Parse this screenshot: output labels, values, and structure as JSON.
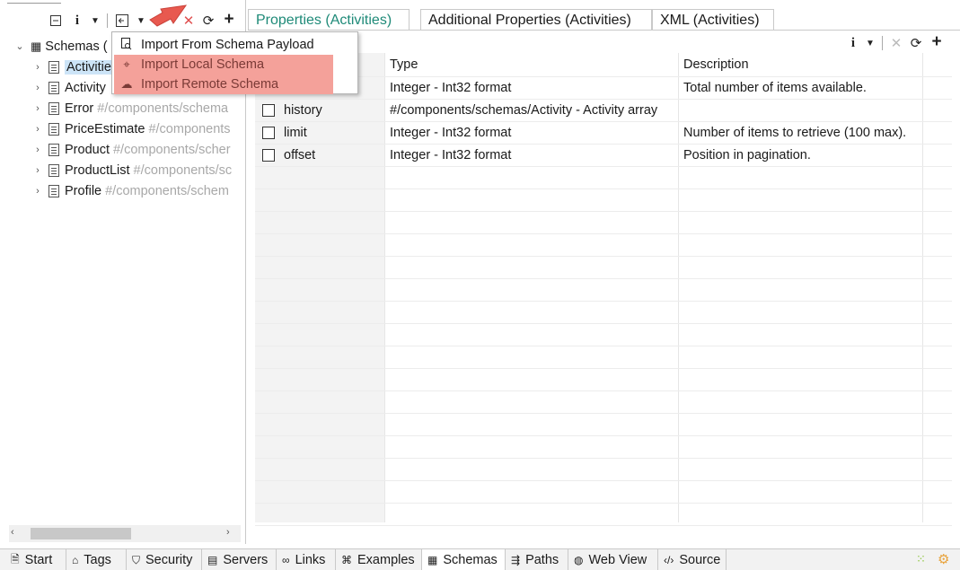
{
  "left_toolbar": {
    "collapse_icon": "collapse-all-icon",
    "info_icon": "info-icon",
    "import_icon": "import-icon",
    "delete_icon": "delete-icon",
    "refresh_icon": "refresh-icon",
    "add_icon": "add-icon"
  },
  "tree": {
    "root_label": "Schemas (",
    "items": [
      {
        "name": "Activitie",
        "ref": "",
        "selected": true
      },
      {
        "name": "Activity",
        "ref": ""
      },
      {
        "name": "Error",
        "ref": "#/components/schema"
      },
      {
        "name": "PriceEstimate",
        "ref": "#/components"
      },
      {
        "name": "Product",
        "ref": "#/components/scher"
      },
      {
        "name": "ProductList",
        "ref": "#/components/sc"
      },
      {
        "name": "Profile",
        "ref": "#/components/schem"
      }
    ]
  },
  "menu": {
    "items": [
      {
        "label": "Import From Schema Payload",
        "icon": "payload-icon"
      },
      {
        "label": "Import Local Schema",
        "icon": "location-icon"
      },
      {
        "label": "Import Remote Schema",
        "icon": "cloud-icon"
      }
    ]
  },
  "tabs": [
    {
      "label": "Properties (Activities)",
      "active": true
    },
    {
      "label": "Additional Properties (Activities)"
    },
    {
      "label": "XML (Activities)"
    }
  ],
  "grid": {
    "headers": {
      "type": "Type",
      "description": "Description"
    },
    "rows": [
      {
        "name": "",
        "type": "Integer - Int32 format",
        "description": "Total number of items available."
      },
      {
        "name": "history",
        "type": "#/components/schemas/Activity - Activity array",
        "description": ""
      },
      {
        "name": "limit",
        "type": "Integer - Int32 format",
        "description": "Number of items to retrieve (100 max)."
      },
      {
        "name": "offset",
        "type": "Integer - Int32 format",
        "description": "Position in pagination."
      }
    ]
  },
  "bottom_tabs": [
    {
      "label": "Start",
      "icon": "document-icon"
    },
    {
      "label": "Tags",
      "icon": "tag-icon"
    },
    {
      "label": "Security",
      "icon": "shield-icon"
    },
    {
      "label": "Servers",
      "icon": "server-icon"
    },
    {
      "label": "Links",
      "icon": "link-icon"
    },
    {
      "label": "Examples",
      "icon": "examples-icon"
    },
    {
      "label": "Schemas",
      "icon": "schemas-icon",
      "active": true
    },
    {
      "label": "Paths",
      "icon": "paths-icon"
    },
    {
      "label": "Web View",
      "icon": "globe-icon"
    },
    {
      "label": "Source",
      "icon": "code-icon"
    }
  ],
  "colors": {
    "accent_tab": "#1e8a78",
    "menu_highlight": "#f4a19a",
    "selection": "#cce4f7",
    "arrow": "#e8594f"
  }
}
